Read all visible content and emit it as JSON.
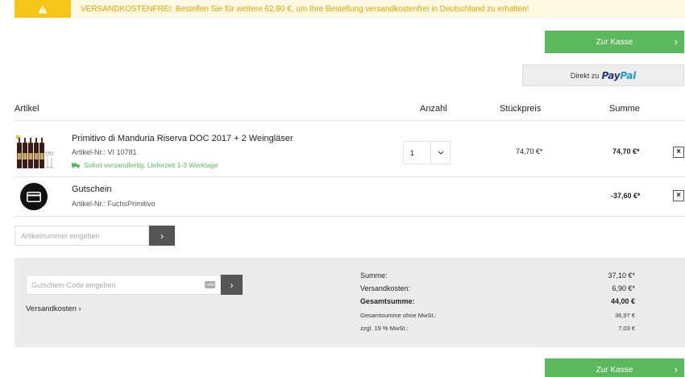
{
  "notice": {
    "highlight": "VERSANDKOSTENFREI",
    "text": ": Bestellen Sie für weitere 62,90 €, um Ihre Bestellung versandkostenfrei in Deutschland zu erhalten!"
  },
  "checkout": {
    "label": "Zur Kasse",
    "chevron": "›"
  },
  "paypal": {
    "prefix": "Direkt zu",
    "logo_pay": "Pay",
    "logo_pal": "Pal"
  },
  "table": {
    "headers": {
      "article": "Artikel",
      "quantity": "Anzahl",
      "unit_price": "Stückpreis",
      "total": "Summe"
    }
  },
  "items": [
    {
      "title": "Primitivo di Manduria Riserva DOC 2017 + 2 Weingläser",
      "sku_label": "Artikel-Nr.:",
      "sku": "VI 10781",
      "shipping": "Sofort versandfertig, Lieferzeit 1-3 Werktage",
      "quantity": "1",
      "unit_price": "74,70 €*",
      "total": "74,70 €*",
      "remove": "×"
    },
    {
      "title": "Gutschein",
      "sku_label": "Artikel-Nr.:",
      "sku": "FuchsPrimitivo",
      "total": "-37,60 €*",
      "remove": "×"
    }
  ],
  "article_input": {
    "placeholder": "Artikelnummer eingeben",
    "button": "›"
  },
  "voucher": {
    "placeholder": "Gutschein-Code eingeben",
    "tag": "code",
    "button": "›"
  },
  "shipping_link": "Versandkosten ›",
  "summary": {
    "rows": [
      {
        "label": "Summe:",
        "value": "37,10 €*"
      },
      {
        "label": "Versandkosten:",
        "value": "6,90 €*"
      },
      {
        "label": "Gesamtsumme:",
        "value": "44,00 €"
      },
      {
        "label": "Gesamtsumme ohne MwSt.:",
        "value": "36,97 €"
      },
      {
        "label": "zzgl. 19 % MwSt.:",
        "value": "7,03 €"
      }
    ]
  },
  "colors": {
    "green": "#5cb85c",
    "notice_yellow": "#f5c518",
    "notice_text": "#e0a400",
    "dark_button": "#555555"
  },
  "icons": [
    "warning-icon",
    "chevron-right-icon",
    "chevron-down-icon",
    "truck-icon",
    "voucher-icon",
    "close-icon"
  ]
}
